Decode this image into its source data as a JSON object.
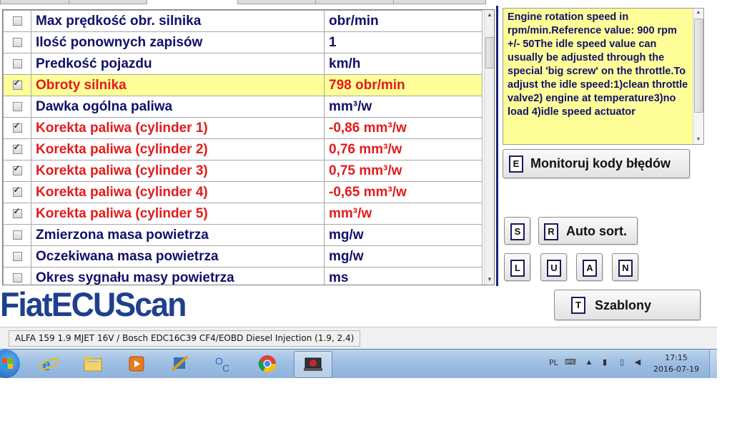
{
  "params_table": {
    "rows": [
      {
        "checked": false,
        "name": "Max prędkość obr. silnika",
        "value": "obr/min"
      },
      {
        "checked": false,
        "name": "Ilość ponownych zapisów",
        "value": "1"
      },
      {
        "checked": false,
        "name": "Predkość pojazdu",
        "value": " km/h"
      },
      {
        "checked": true,
        "name": "Obroty silnika",
        "value": "798 obr/min"
      },
      {
        "checked": false,
        "name": "Dawka ogólna paliwa",
        "value": " mm³/w"
      },
      {
        "checked": true,
        "name": "Korekta paliwa (cylinder 1)",
        "value": "-0,86 mm³/w"
      },
      {
        "checked": true,
        "name": "Korekta paliwa (cylinder 2)",
        "value": "0,76 mm³/w"
      },
      {
        "checked": true,
        "name": "Korekta paliwa (cylinder 3)",
        "value": "0,75 mm³/w"
      },
      {
        "checked": true,
        "name": "Korekta paliwa (cylinder 4)",
        "value": "-0,65 mm³/w"
      },
      {
        "checked": true,
        "name": "Korekta paliwa (cylinder 5)",
        "value": " mm³/w"
      },
      {
        "checked": false,
        "name": "Zmierzona masa powietrza",
        "value": " mg/w"
      },
      {
        "checked": false,
        "name": "Oczekiwana masa powietrza",
        "value": " mg/w"
      },
      {
        "checked": false,
        "name": "Okres sygnału masy powietrza",
        "value": " ms"
      }
    ],
    "highlighted_row": 3
  },
  "info_box": {
    "text": "Engine rotation speed in rpm/min.Reference value: 900 rpm +/- 50The idle speed value can usually be adjusted through the special 'big screw' on the throttle.To adjust the idle speed:1)clean throttle valve2) engine at temperature3)no load 4)idle speed actuator"
  },
  "buttons": {
    "monitor": {
      "key": "E",
      "label": "Monitoruj kody błędów"
    },
    "s": {
      "key": "S"
    },
    "autosort": {
      "key": "R",
      "label": "Auto sort."
    },
    "l": {
      "key": "L"
    },
    "u": {
      "key": "U"
    },
    "a": {
      "key": "A"
    },
    "n": {
      "key": "N"
    },
    "templates": {
      "key": "T",
      "label": "Szablony"
    }
  },
  "logo": {
    "text": "FiatECUScan"
  },
  "status_bar": {
    "text": "ALFA 159 1.9 MJET 16V / Bosch EDC16C39 CF4/EOBD Diesel Injection (1.9, 2.4)"
  },
  "taskbar": {
    "items": [
      "start-button",
      "internet-explorer-icon",
      "file-explorer-icon",
      "media-player-icon",
      "tools-icon",
      "oc-app-icon",
      "chrome-icon",
      "fiatecuscan-taskbar-icon"
    ],
    "tray_lang": "PL",
    "clock_time": "17:15",
    "clock_date": "2016-07-19"
  },
  "colors": {
    "header_text": "#10106a",
    "selected_text": "#e31b1b",
    "highlight_bg": "#ffff99",
    "divider": "#1a2478",
    "logo": "#1f3f8f"
  }
}
